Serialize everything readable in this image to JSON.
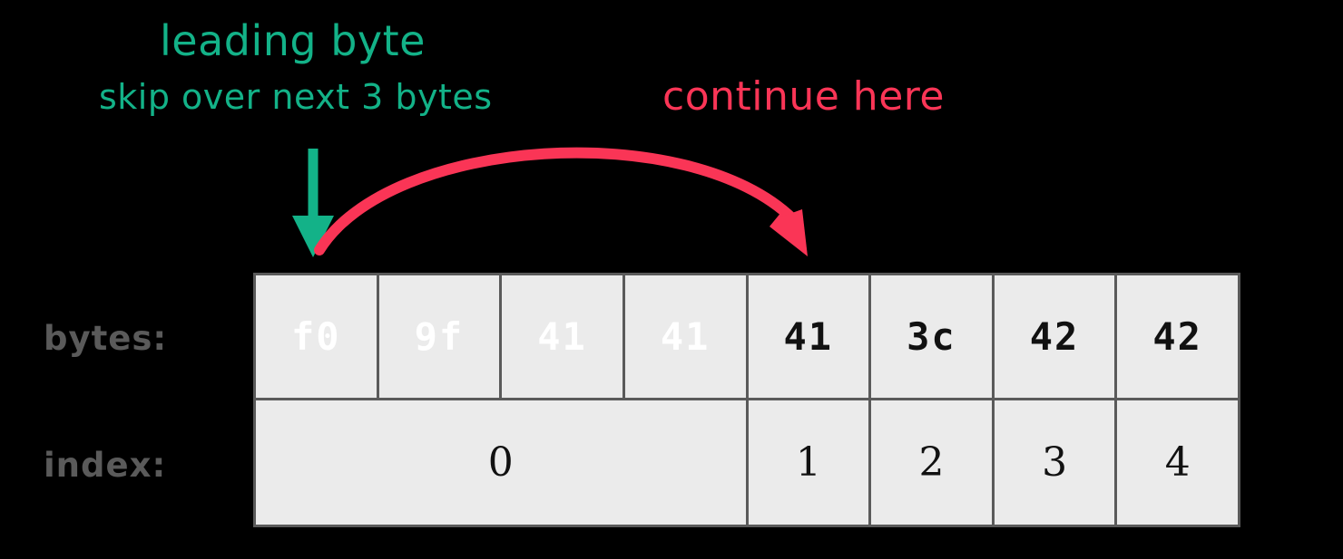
{
  "diagram": {
    "title_annotation": "leading byte",
    "subtitle_annotation": "skip over next 3 bytes",
    "continue_annotation": "continue here"
  },
  "colors": {
    "background": "#000000",
    "leading_byte_fill": "#18b48f",
    "continuation_byte_fill": "#2626a8",
    "plain_cell_fill": "#ebebeb",
    "grid_border": "#5a5a5a",
    "green_accent": "#13b288",
    "red_accent": "#fa3556",
    "label_text": "#5a5a5a"
  },
  "labels": {
    "bytes": "bytes:",
    "index": "index:"
  },
  "bytes_row": {
    "cells": [
      {
        "value": "f0",
        "kind": "leading"
      },
      {
        "value": "9f",
        "kind": "continuation"
      },
      {
        "value": "41",
        "kind": "continuation"
      },
      {
        "value": "41",
        "kind": "continuation"
      },
      {
        "value": "41",
        "kind": "plain"
      },
      {
        "value": "3c",
        "kind": "plain"
      },
      {
        "value": "42",
        "kind": "plain"
      },
      {
        "value": "42",
        "kind": "plain"
      }
    ]
  },
  "index_row": {
    "cells": [
      {
        "value": "0",
        "span": 4
      },
      {
        "value": "1",
        "span": 1
      },
      {
        "value": "2",
        "span": 1
      },
      {
        "value": "3",
        "span": 1
      },
      {
        "value": "4",
        "span": 1
      }
    ]
  },
  "arrows": {
    "down_arrow": {
      "name": "green-down-arrow",
      "color": "#13b288",
      "points_to": "f0"
    },
    "skip_arrow": {
      "name": "red-curved-skip-arrow",
      "color": "#fa3556",
      "from": "f0",
      "to": "41"
    }
  }
}
